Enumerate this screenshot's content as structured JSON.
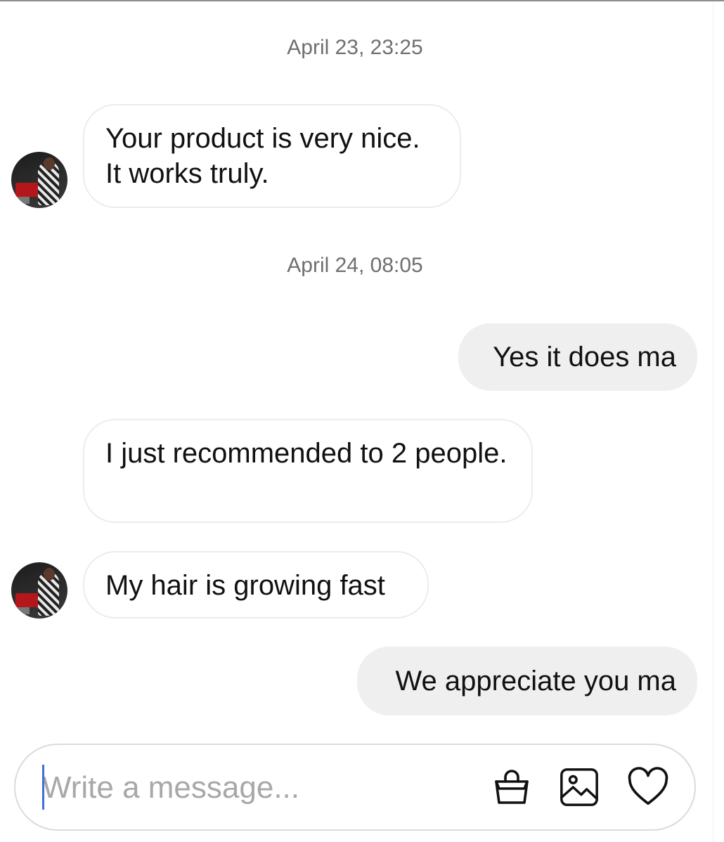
{
  "conversation": {
    "timestamps": [
      "April 23, 23:25",
      "April 24, 08:05"
    ],
    "messages": [
      {
        "text": "Your product is very nice. It works truly."
      },
      {
        "text": "Yes it does ma"
      },
      {
        "text": "I just recommended to 2 people."
      },
      {
        "text": "My hair is growing fast"
      },
      {
        "text": "We appreciate you ma"
      }
    ]
  },
  "composer": {
    "placeholder": "Write a message...",
    "icons": [
      "shopping-bag-icon",
      "image-icon",
      "heart-icon"
    ]
  },
  "colors": {
    "outgoing_bubble": "#efefef",
    "incoming_border": "#ececec",
    "timestamp": "#6f6f6f",
    "caret": "#3d6fd6"
  }
}
